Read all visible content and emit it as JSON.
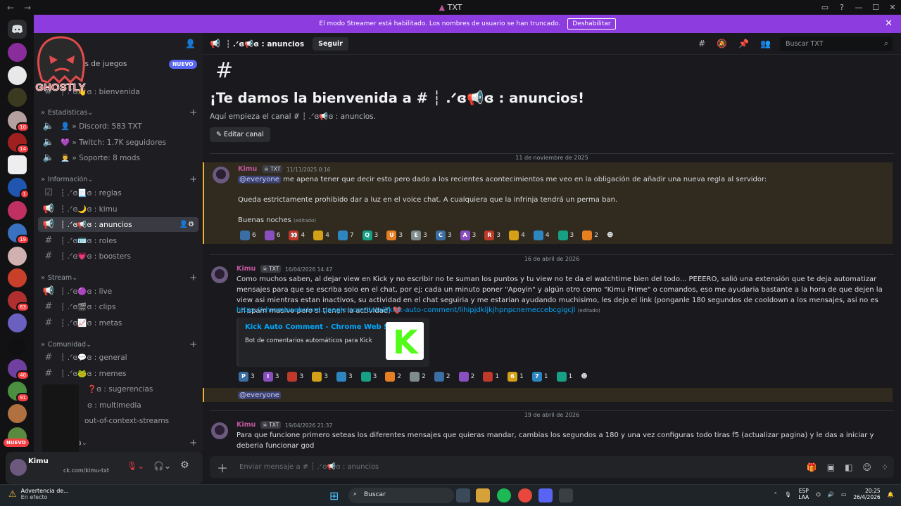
{
  "window": {
    "title": "TXT"
  },
  "banner": {
    "text": "El modo Streamer está habilitado. Los nombres de usuario se han truncado.",
    "button": "Deshabilitar"
  },
  "overlay": {
    "logo_text": "GHOSTLY"
  },
  "sidebar": {
    "top_item": "es de juegos",
    "nuevo_badge": "NUEVO",
    "top_channel": "┆ .ᐟɞ👋ɞ : bienvenida",
    "categories": [
      {
        "label": "Estadísticas",
        "channels": [
          "👤 » Discord: 583 TXT",
          "💜 » Twitch: 1.7K seguidores",
          "👨‍💼 » Soporte: 8 mods"
        ]
      },
      {
        "label": "Información",
        "channels": [
          "┆ .ᐟɞ📃ɞ : reglas",
          "┆ .ᐟɞ🌙ɞ : kimu",
          "┆ .ᐟɞ📢ɞ : anuncios",
          "┆ .ᐟɞ🪪ɞ : roles",
          "┆ .ᐟɞ💗ɞ : boosters"
        ]
      },
      {
        "label": "Stream",
        "channels": [
          "┆ .ᐟɞ🟣ɞ : live",
          "┆ .ᐟɞ🎬ɞ : clips",
          "┆ .ᐟɞ📈ɞ : metas"
        ]
      },
      {
        "label": "Comunidad",
        "channels": [
          "┆ .ᐟɞ💬ɞ : general",
          "┆ .ᐟɞ🐸ɞ : memes",
          "❓ɞ : sugerencias",
          "ɞ : multimedia",
          "out-of-context-streams"
        ]
      }
    ],
    "collapsed_cat": "a",
    "user": {
      "name": "Kimu",
      "status": "ck.com/kimu-txt"
    }
  },
  "guild_badges": [
    "10",
    "14",
    "1",
    "19",
    "63",
    "40",
    "91",
    "NUEVO"
  ],
  "header": {
    "channel": "┆ .ᐟɞ📢ɞ : anuncios",
    "follow": "Seguir",
    "search_placeholder": "Buscar TXT"
  },
  "welcome": {
    "title": "¡Te damos la bienvenida a # ┆ .ᐟɞ📢ɞ : anuncios!",
    "subtitle": "Aquí empieza el canal # ┆ .ᐟɞ📢ɞ : anuncios.",
    "edit": "Editar canal"
  },
  "dividers": [
    "11 de noviembre de 2025",
    "16 de abril de 2026",
    "19 de abril de 2026"
  ],
  "messages": [
    {
      "author": "Kimu",
      "tag": "TXT",
      "time": "11/11/2025 0:16",
      "mention": "@everyone",
      "line1": "me apena tener que decir esto pero dado a los recientes acontecimientos me veo en la obligación de añadir una nueva regla al servidor:",
      "line2": "Queda estrictamente prohibido dar a luz en el voice chat. A cualquiera que la infrinja tendrá un perma ban.",
      "line3": "Buenas noches",
      "edited": "(editado)",
      "reactions": [
        [
          "",
          "6"
        ],
        [
          "",
          "6"
        ],
        [
          "👀",
          "4"
        ],
        [
          "",
          "4"
        ],
        [
          "",
          "7"
        ],
        [
          "Q",
          "3"
        ],
        [
          "U",
          "3"
        ],
        [
          "E",
          "3"
        ],
        [
          "C",
          "3"
        ],
        [
          "A",
          "3"
        ],
        [
          "R",
          "3"
        ],
        [
          "",
          "4"
        ],
        [
          "",
          "4"
        ],
        [
          "",
          "3"
        ],
        [
          "",
          "2"
        ]
      ]
    },
    {
      "author": "Kimu",
      "tag": "TXT",
      "time": "16/04/2026 14:47",
      "body": "Como muchos saben, al dejar view en Kick y no escribir no te suman los puntos y tu view no te da el watchtime bien del todo... PEEERO, salió una extensión que te deja automatizar mensajes para que se escriba solo en el chat, por ej; cada un minuto poner \"Apoyin\" y algún otro como \"Kimu Prime\" o comandos, eso me ayudaria bastante a la hora de que dejen la view asi mientras estan inactivos, su actividad en el chat seguiria y me estarian ayudando muchisimo, les dejo el link (ponganle 180 segundos de cooldown a los mensajes, asi no es un spam masivo pero si tienen la actividad) ❤️",
      "link": "https://chromewebstore.google.com/detail/kick-auto-comment/lihipjdkljkjhpnpcnemeccebcgigcjl",
      "edited": "(editado)",
      "embed_title": "Kick Auto Comment - Chrome Web Store",
      "embed_desc": "Bot de comentarios automáticos para Kick",
      "reactions": [
        [
          "P",
          "3"
        ],
        [
          "I",
          "3"
        ],
        [
          "",
          "3"
        ],
        [
          "",
          "3"
        ],
        [
          "",
          "3"
        ],
        [
          "",
          "3"
        ],
        [
          "",
          "2"
        ],
        [
          "",
          "2"
        ],
        [
          "",
          "2"
        ],
        [
          "",
          "2"
        ],
        [
          "",
          "1"
        ],
        [
          "6",
          "1"
        ],
        [
          "7",
          "1"
        ],
        [
          "",
          "1"
        ]
      ],
      "followup": "@everyone"
    },
    {
      "author": "Kimu",
      "tag": "TXT",
      "time": "19/04/2026 21:37",
      "body": "Para que funcione primero seteas los diferentes mensajes que quieras mandar, cambias los segundos a 180 y una vez configuras todo tiras f5 (actualizar pagina) y le das a iniciar y deberia funcionar god"
    }
  ],
  "composer": {
    "placeholder": "Enviar mensaje a # ┆ .ᐟɞ📢ɞ : anuncios"
  },
  "taskbar": {
    "warning_title": "Advertencia de...",
    "warning_sub": "En efecto",
    "search": "Buscar",
    "lang1": "ESP",
    "lang2": "LAA",
    "time": "20:25",
    "date": "26/4/2026"
  }
}
